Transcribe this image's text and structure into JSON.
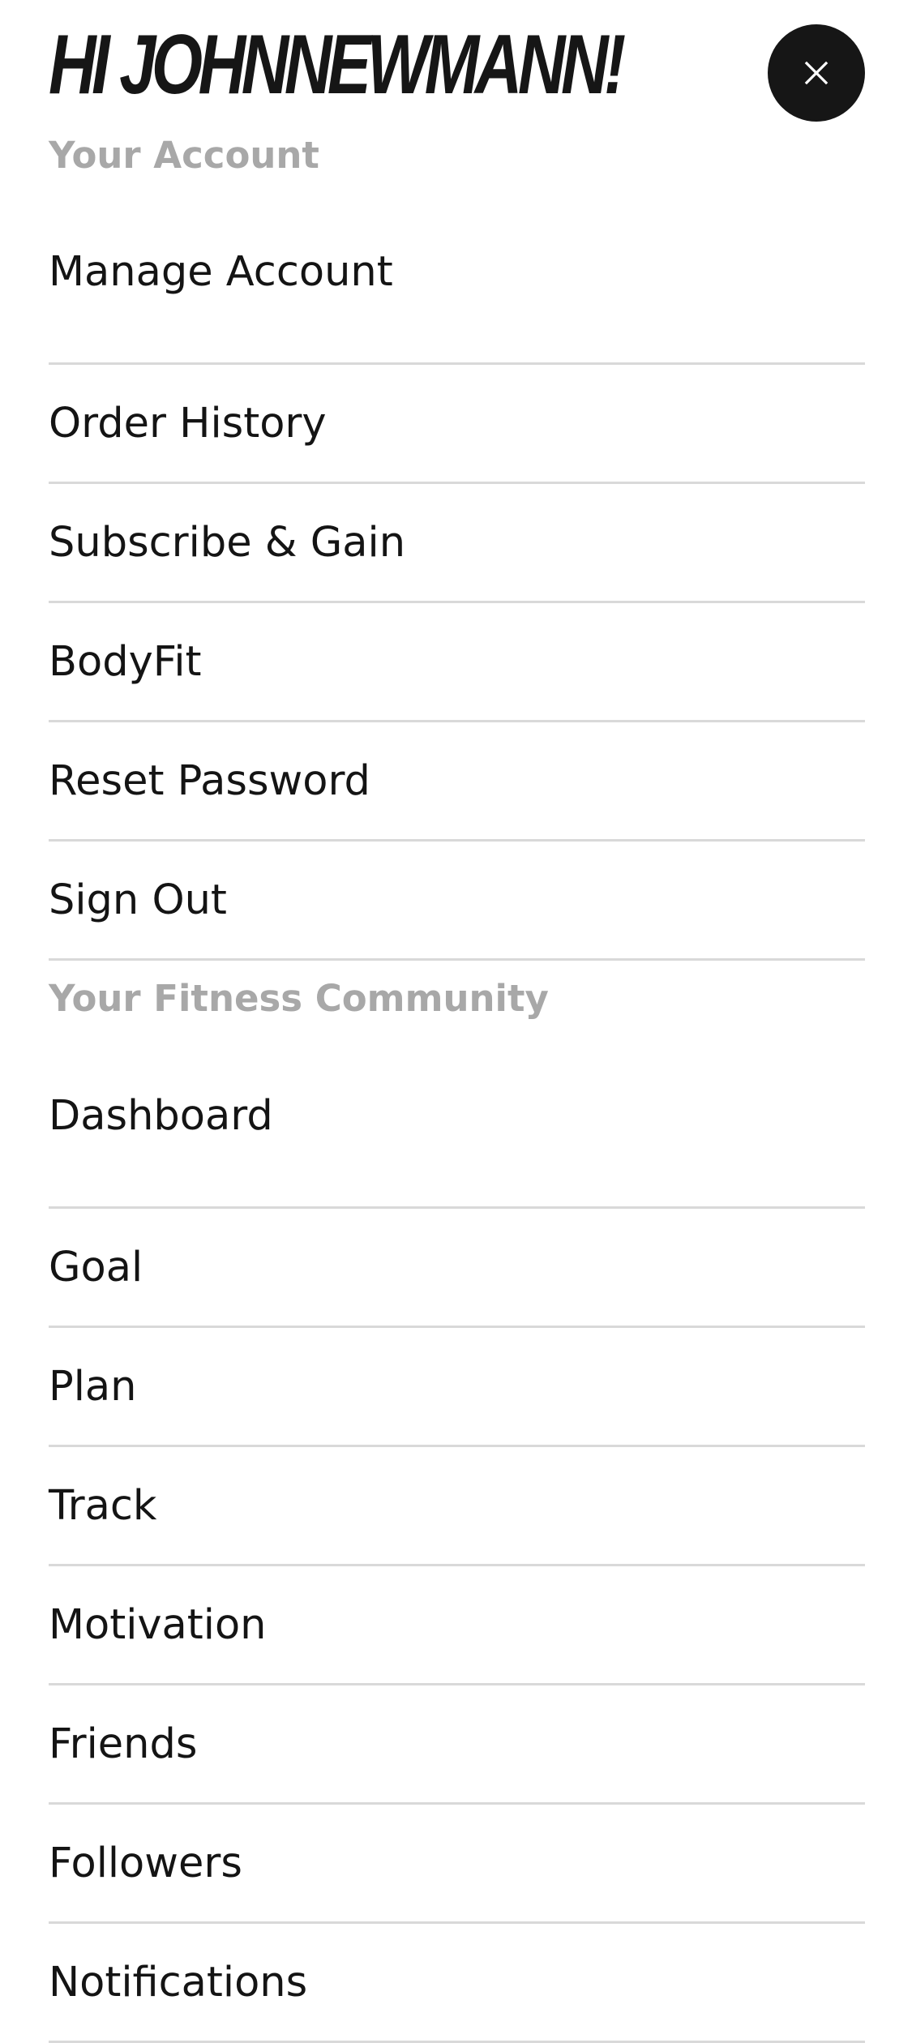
{
  "header": {
    "greeting": "HI JOHNNEWMANN!",
    "close_label": "X"
  },
  "account_section": {
    "heading": "Your Account",
    "items": [
      {
        "label": "Manage Account"
      },
      {
        "label": "Order History"
      },
      {
        "label": "Subscribe & Gain"
      },
      {
        "label": "BodyFit"
      },
      {
        "label": "Reset Password"
      },
      {
        "label": "Sign Out"
      }
    ]
  },
  "community_section": {
    "heading": "Your Fitness Community",
    "items": [
      {
        "label": "Dashboard"
      },
      {
        "label": "Goal"
      },
      {
        "label": "Plan"
      },
      {
        "label": "Track"
      },
      {
        "label": "Motivation"
      },
      {
        "label": "Friends"
      },
      {
        "label": "Followers"
      },
      {
        "label": "Notifications"
      }
    ]
  },
  "colors": {
    "close_button_bg": "#161616",
    "heading_gray": "#a8a8a8",
    "divider": "#d9d9d9",
    "text": "#141414"
  }
}
